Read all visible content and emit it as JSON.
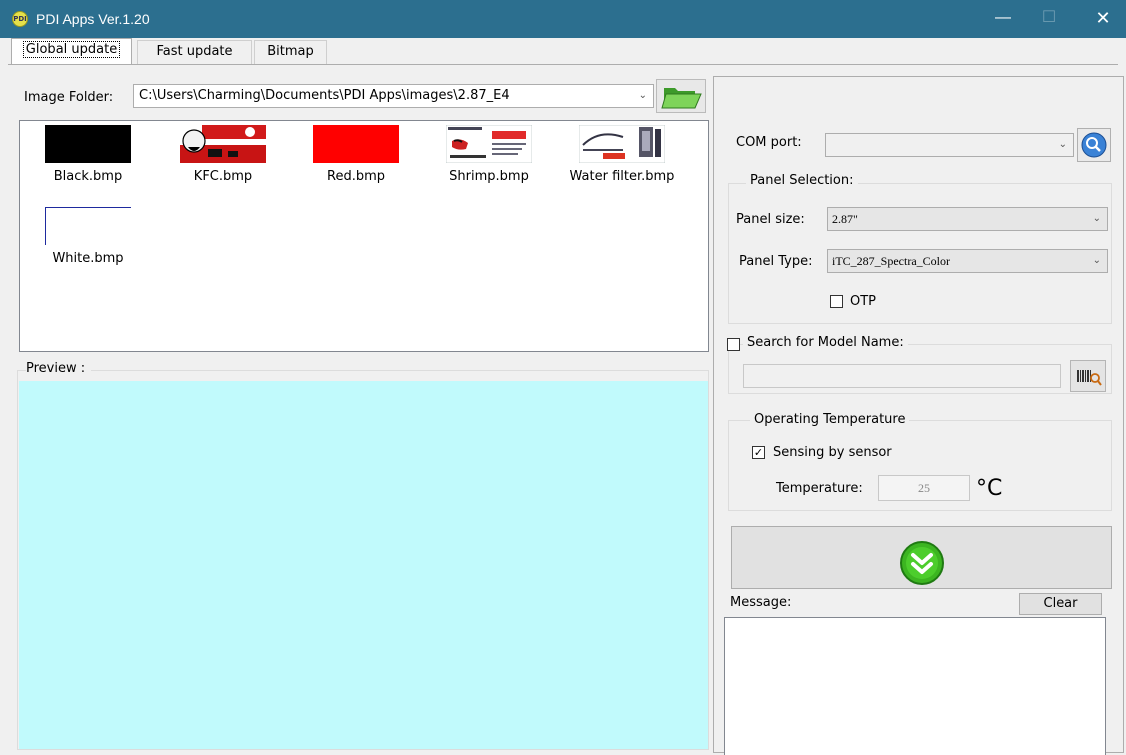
{
  "window": {
    "title": "PDI Apps Ver.1.20",
    "logo_text": "PDI",
    "minimize": "—",
    "maximize": "☐",
    "close": "✕"
  },
  "tabs": [
    {
      "label": "Global update",
      "active": true
    },
    {
      "label": "Fast update",
      "active": false
    },
    {
      "label": "Bitmap",
      "active": false
    }
  ],
  "image_folder": {
    "label": "Image Folder:",
    "path": "C:\\Users\\Charming\\Documents\\PDI Apps\\images\\2.87_E4",
    "browse_icon": "open-folder-icon"
  },
  "files": [
    {
      "name": "Black.bmp"
    },
    {
      "name": "KFC.bmp"
    },
    {
      "name": "Red.bmp"
    },
    {
      "name": "Shrimp.bmp"
    },
    {
      "name": "Water filter.bmp"
    },
    {
      "name": "White.bmp"
    }
  ],
  "preview": {
    "label": "Preview :"
  },
  "com_port": {
    "label": "COM port:",
    "value": ""
  },
  "panel_selection": {
    "title": "Panel Selection:",
    "size_label": "Panel size:",
    "size_value": "2.87\"",
    "type_label": "Panel Type:",
    "type_value": "iTC_287_Spectra_Color",
    "otp_label": "OTP",
    "otp_checked": false
  },
  "model_search": {
    "label": "Search for Model Name:",
    "checked": false,
    "value": ""
  },
  "operating_temp": {
    "title": "Operating Temperature",
    "sensing_label": "Sensing by sensor",
    "sensing_checked": true,
    "temp_label": "Temperature:",
    "temp_value": "25",
    "unit": "°C"
  },
  "message": {
    "label": "Message:",
    "clear_label": "Clear",
    "content": ""
  },
  "colors": {
    "titlebar": "#2c6f8f",
    "preview_bg": "#c1fafc",
    "go_green": "#3cb521"
  }
}
